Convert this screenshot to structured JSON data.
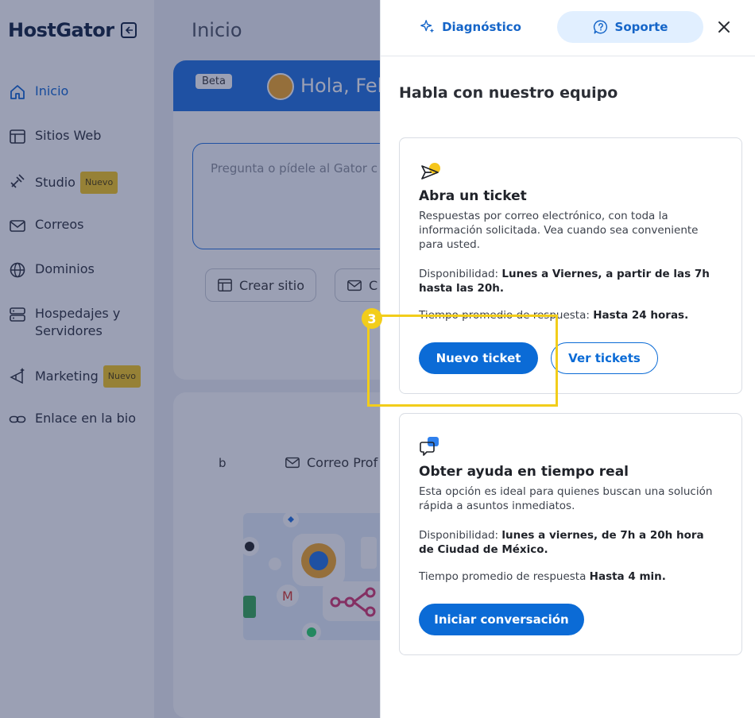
{
  "app": {
    "brand": "HostGator",
    "page_title": "Inicio"
  },
  "sidebar": {
    "items": [
      {
        "label": "Inicio",
        "icon": "home-icon",
        "active": true
      },
      {
        "label": "Sitios Web",
        "icon": "layout-icon"
      },
      {
        "label": "Studio",
        "icon": "studio-icon",
        "badge": "Nuevo"
      },
      {
        "label": "Correos",
        "icon": "mail-icon"
      },
      {
        "label": "Dominios",
        "icon": "globe-icon"
      },
      {
        "label": "Hospedajes y Servidores",
        "icon": "server-icon"
      },
      {
        "label": "Marketing",
        "icon": "sparkle-megaphone-icon",
        "badge": "Nuevo"
      },
      {
        "label": "Enlace en la bio",
        "icon": "link-icon"
      }
    ]
  },
  "hero": {
    "beta": "Beta",
    "greeting": "Hola, Fel",
    "ask_placeholder": "Pregunta o pídele al Gator c",
    "chips": [
      "Crear sitio",
      "C"
    ]
  },
  "second_card": {
    "tab_b": "b",
    "mail_label": "Correo Prof"
  },
  "panel": {
    "tabs": {
      "diagnostico": "Diagnóstico",
      "soporte": "Soporte"
    },
    "title": "Habla con nuestro equipo",
    "ticket": {
      "title": "Abra un ticket",
      "description": "Respuestas por correo electrónico, con toda la información solicitada. Vea cuando sea conveniente para usted.",
      "availability_label": "Disponibilidad:",
      "availability_value": "Lunes a Viernes, a partir de las 7h hasta las 20h.",
      "response_label": "Tiempo promedio de respuesta:",
      "response_value": "Hasta 24 horas.",
      "primary_button": "Nuevo ticket",
      "secondary_button": "Ver tickets"
    },
    "chat": {
      "title": "Obter ayuda en tiempo real",
      "description": "Esta opción es ideal para quienes buscan una solución rápida a asuntos inmediatos.",
      "availability_label": "Disponibilidad:",
      "availability_value": "lunes a viernes, de 7h a 20h hora de Ciudad de México.",
      "response_label": "Tiempo promedio de respuesta",
      "response_value": "Hasta 4 min.",
      "primary_button": "Iniciar conversación"
    }
  },
  "annotation": {
    "step": "3"
  },
  "colors": {
    "accent": "#0b6bd6",
    "tab_active_bg": "#e1efff",
    "highlight": "#f2cd1a",
    "badge_new": "#f6c61b"
  }
}
